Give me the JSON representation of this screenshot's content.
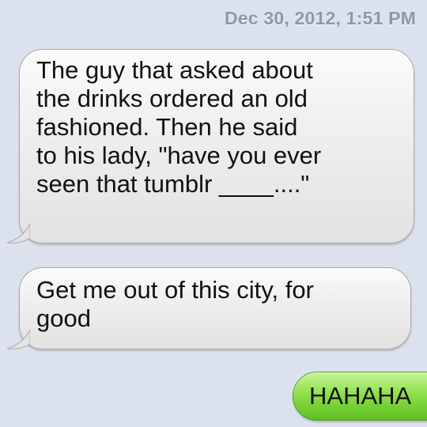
{
  "thread": {
    "timestamp": "Dec 30, 2012, 1:51 PM",
    "messages": [
      {
        "sender": "received",
        "text": "The guy that asked about\nthe drinks ordered an old\nfashioned.  Then he said\nto his lady, \"have you ever\nseen that tumblr ____....\""
      },
      {
        "sender": "received",
        "text": "Get me out of this city, for\ngood"
      },
      {
        "sender": "sent",
        "text": "HAHAHA"
      }
    ]
  },
  "colors": {
    "background": "#dbe2ed",
    "received_bubble": "#eeeeee",
    "sent_bubble": "#8fe04a",
    "timestamp_text": "#8e98a8"
  }
}
